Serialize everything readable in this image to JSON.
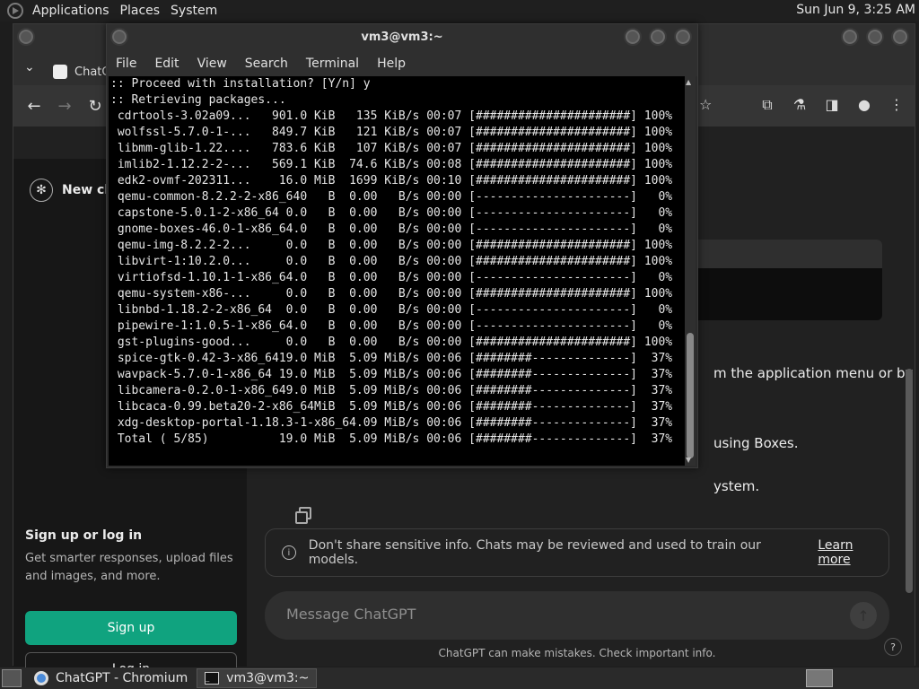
{
  "top_panel": {
    "menus": [
      "Applications",
      "Places",
      "System"
    ],
    "clock": "Sun Jun  9,  3:25 AM"
  },
  "chrome": {
    "tab_title": "ChatG",
    "sidebar": {
      "new_chat": "New ch",
      "signup_title": "Sign up or log in",
      "signup_desc": "Get smarter responses, upload files and images, and more.",
      "signup_button": "Sign up",
      "login_button": "Log in"
    },
    "main": {
      "text_line1": "m the application menu or by",
      "text_line2": "using Boxes.",
      "text_line3": "ystem.",
      "notice": "Don't share sensitive info. Chats may be reviewed and used to train our models.",
      "learn_more": "Learn more",
      "message_placeholder": "Message ChatGPT",
      "disclaimer": "ChatGPT can make mistakes. Check important info.",
      "help": "?"
    }
  },
  "terminal": {
    "title": "vm3@vm3:~",
    "menu": [
      "File",
      "Edit",
      "View",
      "Search",
      "Terminal",
      "Help"
    ],
    "lines": [
      ":: Proceed with installation? [Y/n] y",
      ":: Retrieving packages...",
      " cdrtools-3.02a09...   901.0 KiB   135 KiB/s 00:07 [######################] 100%",
      " wolfssl-5.7.0-1-...   849.7 KiB   121 KiB/s 00:07 [######################] 100%",
      " libmm-glib-1.22....   783.6 KiB   107 KiB/s 00:07 [######################] 100%",
      " imlib2-1.12.2-2-...   569.1 KiB  74.6 KiB/s 00:08 [######################] 100%",
      " edk2-ovmf-202311...    16.0 MiB  1699 KiB/s 00:10 [######################] 100%",
      " qemu-common-8.2.2-2-x86_640   B  0.00   B/s 00:00 [----------------------]   0%",
      " capstone-5.0.1-2-x86_64 0.0   B  0.00   B/s 00:00 [----------------------]   0%",
      " gnome-boxes-46.0-1-x86_64.0   B  0.00   B/s 00:00 [----------------------]   0%",
      " qemu-img-8.2.2-2...     0.0   B  0.00   B/s 00:00 [######################] 100%",
      " libvirt-1:10.2.0...     0.0   B  0.00   B/s 00:00 [######################] 100%",
      " virtiofsd-1.10.1-1-x86_64.0   B  0.00   B/s 00:00 [----------------------]   0%",
      " qemu-system-x86-...     0.0   B  0.00   B/s 00:00 [######################] 100%",
      " libnbd-1.18.2-2-x86_64  0.0   B  0.00   B/s 00:00 [----------------------]   0%",
      " pipewire-1:1.0.5-1-x86_64.0   B  0.00   B/s 00:00 [----------------------]   0%",
      " gst-plugins-good...     0.0   B  0.00   B/s 00:00 [######################] 100%",
      " spice-gtk-0.42-3-x86_6419.0 MiB  5.09 MiB/s 00:06 [########--------------]  37%",
      " wavpack-5.7.0-1-x86_64 19.0 MiB  5.09 MiB/s 00:06 [########--------------]  37%",
      " libcamera-0.2.0-1-x86_649.0 MiB  5.09 MiB/s 00:06 [########--------------]  37%",
      " libcaca-0.99.beta20-2-x86_64MiB  5.09 MiB/s 00:06 [########--------------]  37%",
      " xdg-desktop-portal-1.18.3-1-x86_64.09 MiB/s 00:06 [########--------------]  37%",
      " Total ( 5/85)          19.0 MiB  5.09 MiB/s 00:06 [########--------------]  37%"
    ]
  },
  "taskbar": {
    "items": [
      "ChatGPT - Chromium",
      "vm3@vm3:~"
    ]
  }
}
